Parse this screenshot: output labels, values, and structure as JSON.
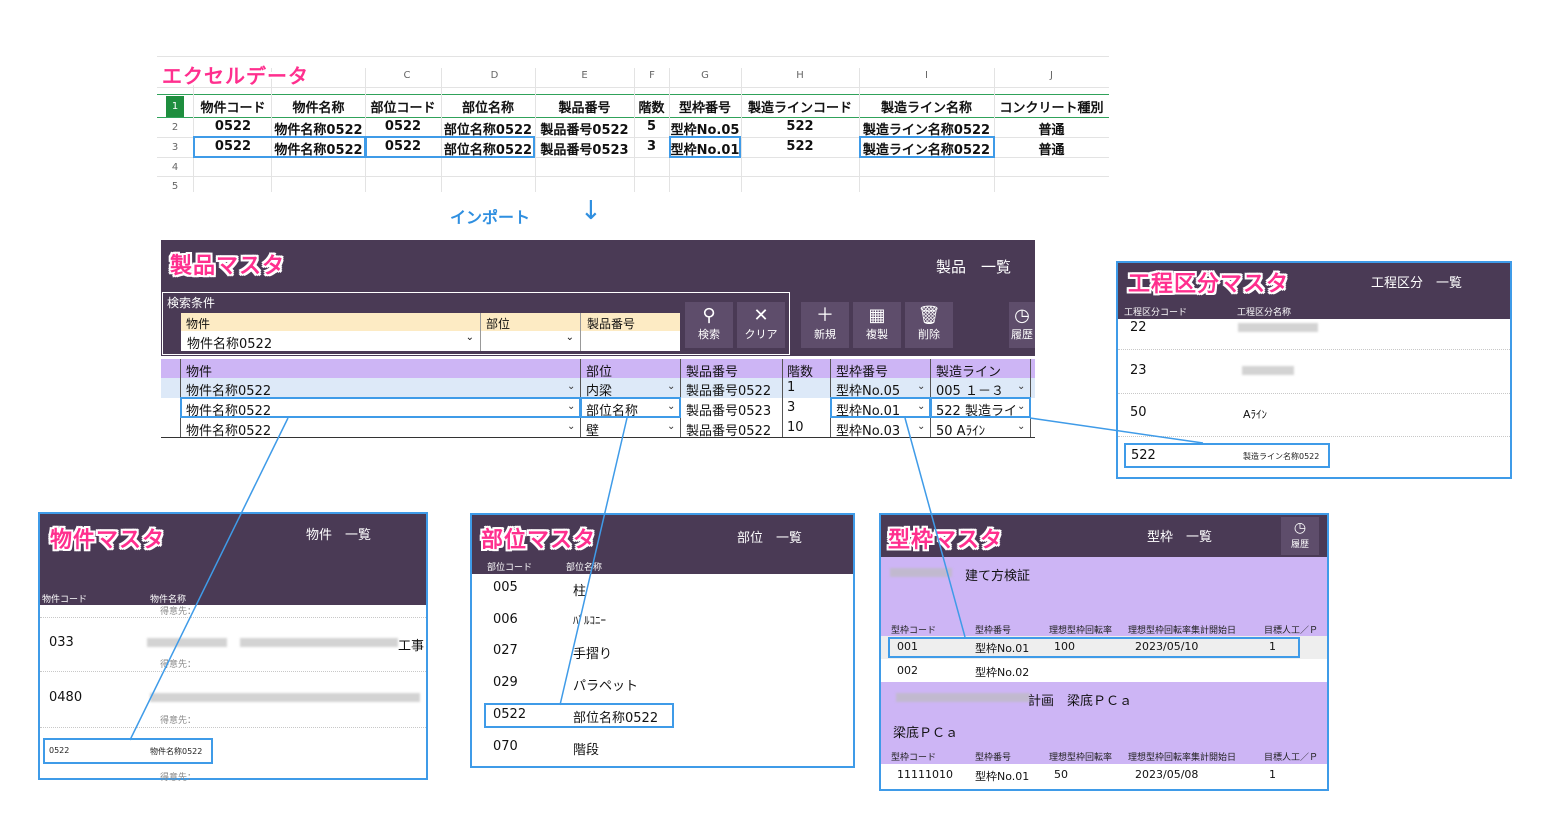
{
  "excel": {
    "title": "エクセルデータ",
    "col_letters": [
      "C",
      "D",
      "E",
      "F",
      "G",
      "H",
      "I",
      "J"
    ],
    "row_numbers": [
      "1",
      "2",
      "3",
      "4",
      "5"
    ],
    "headers": [
      "物件コード",
      "物件名称",
      "部位コード",
      "部位名称",
      "製品番号",
      "階数",
      "型枠番号",
      "製造ラインコード",
      "製造ライン名称",
      "コンクリート種別"
    ],
    "rows": [
      [
        "0522",
        "物件名称0522",
        "0522",
        "部位名称0522",
        "製品番号0522",
        "5",
        "型枠No.05",
        "522",
        "製造ライン名称0522",
        "普通"
      ],
      [
        "0522",
        "物件名称0522",
        "0522",
        "部位名称0522",
        "製品番号0523",
        "3",
        "型枠No.01",
        "522",
        "製造ライン名称0522",
        "普通"
      ]
    ]
  },
  "import_label": "インポート",
  "product_master": {
    "title": "製品マスタ",
    "list_label": "製品　一覧",
    "search": {
      "section_label": "検索条件",
      "property_label": "物件",
      "part_label": "部位",
      "product_no_label": "製品番号",
      "property_value": "物件名称0522",
      "part_value": "",
      "product_no_value": ""
    },
    "buttons": {
      "search": "検索",
      "clear": "クリア",
      "new": "新規",
      "copy": "複製",
      "delete": "削除",
      "history": "履歴"
    },
    "grid_headers": [
      "物件",
      "部位",
      "製品番号",
      "階数",
      "型枠番号",
      "製造ライン"
    ],
    "grid_rows": [
      [
        "物件名称0522",
        "内梁",
        "製品番号0522",
        "1",
        "型枠No.05",
        "005 １－３"
      ],
      [
        "物件名称0522",
        "部位名称",
        "製品番号0523",
        "3",
        "型枠No.01",
        "522 製造ライ"
      ],
      [
        "物件名称0522",
        "壁",
        "製品番号0522",
        "10",
        "型枠No.03",
        "50 Aﾗｲﾝ"
      ]
    ]
  },
  "process_master": {
    "title": "工程区分マスタ",
    "list_label": "工程区分　一覧",
    "col_code": "工程区分コード",
    "col_name": "工程区分名称",
    "rows": [
      {
        "code": "22",
        "name": ""
      },
      {
        "code": "23",
        "name": ""
      },
      {
        "code": "50",
        "name": "Aﾗｲﾝ"
      },
      {
        "code": "522",
        "name": "製造ライン名称0522"
      }
    ]
  },
  "property_master": {
    "title": "物件マスタ",
    "list_label": "物件　一覧",
    "col_code": "物件コード",
    "col_name": "物件名称",
    "client_label": "得意先：",
    "rows": [
      {
        "code": "033",
        "name_suffix": "工事"
      },
      {
        "code": "0480",
        "name_suffix": ""
      },
      {
        "code": "0522",
        "name_suffix": "物件名称0522"
      }
    ]
  },
  "part_master": {
    "title": "部位マスタ",
    "list_label": "部位　一覧",
    "col_code": "部位コード",
    "col_name": "部位名称",
    "rows": [
      {
        "code": "005",
        "name": "柱"
      },
      {
        "code": "006",
        "name": "ﾊﾞﾙｺﾆｰ"
      },
      {
        "code": "027",
        "name": "手摺り"
      },
      {
        "code": "029",
        "name": "パラペット"
      },
      {
        "code": "0522",
        "name": "部位名称0522"
      },
      {
        "code": "070",
        "name": "階段"
      }
    ]
  },
  "form_master": {
    "title": "型枠マスタ",
    "list_label": "型枠　一覧",
    "history": "履歴",
    "group1_name": "建て方検証",
    "group2_name": "計画　梁底ＰＣａ",
    "group2_sub": "梁底ＰＣａ",
    "headers": [
      "型枠コード",
      "型枠番号",
      "理想型枠回転率",
      "理想型枠回転率集計開始日",
      "目標人工／Ｐ"
    ],
    "group1_rows": [
      [
        "001",
        "型枠No.01",
        "100",
        "2023/05/10",
        "1"
      ],
      [
        "002",
        "型枠No.02",
        "",
        "",
        ""
      ]
    ],
    "group2_rows": [
      [
        "11111010",
        "型枠No.01",
        "50",
        "2023/05/08",
        "1"
      ]
    ]
  },
  "colors": {
    "purple_bar": "#4a3a55",
    "lavender": "#cdb5f5",
    "highlight_blue": "#3f9be8",
    "title_pink": "#ff2f8e"
  }
}
